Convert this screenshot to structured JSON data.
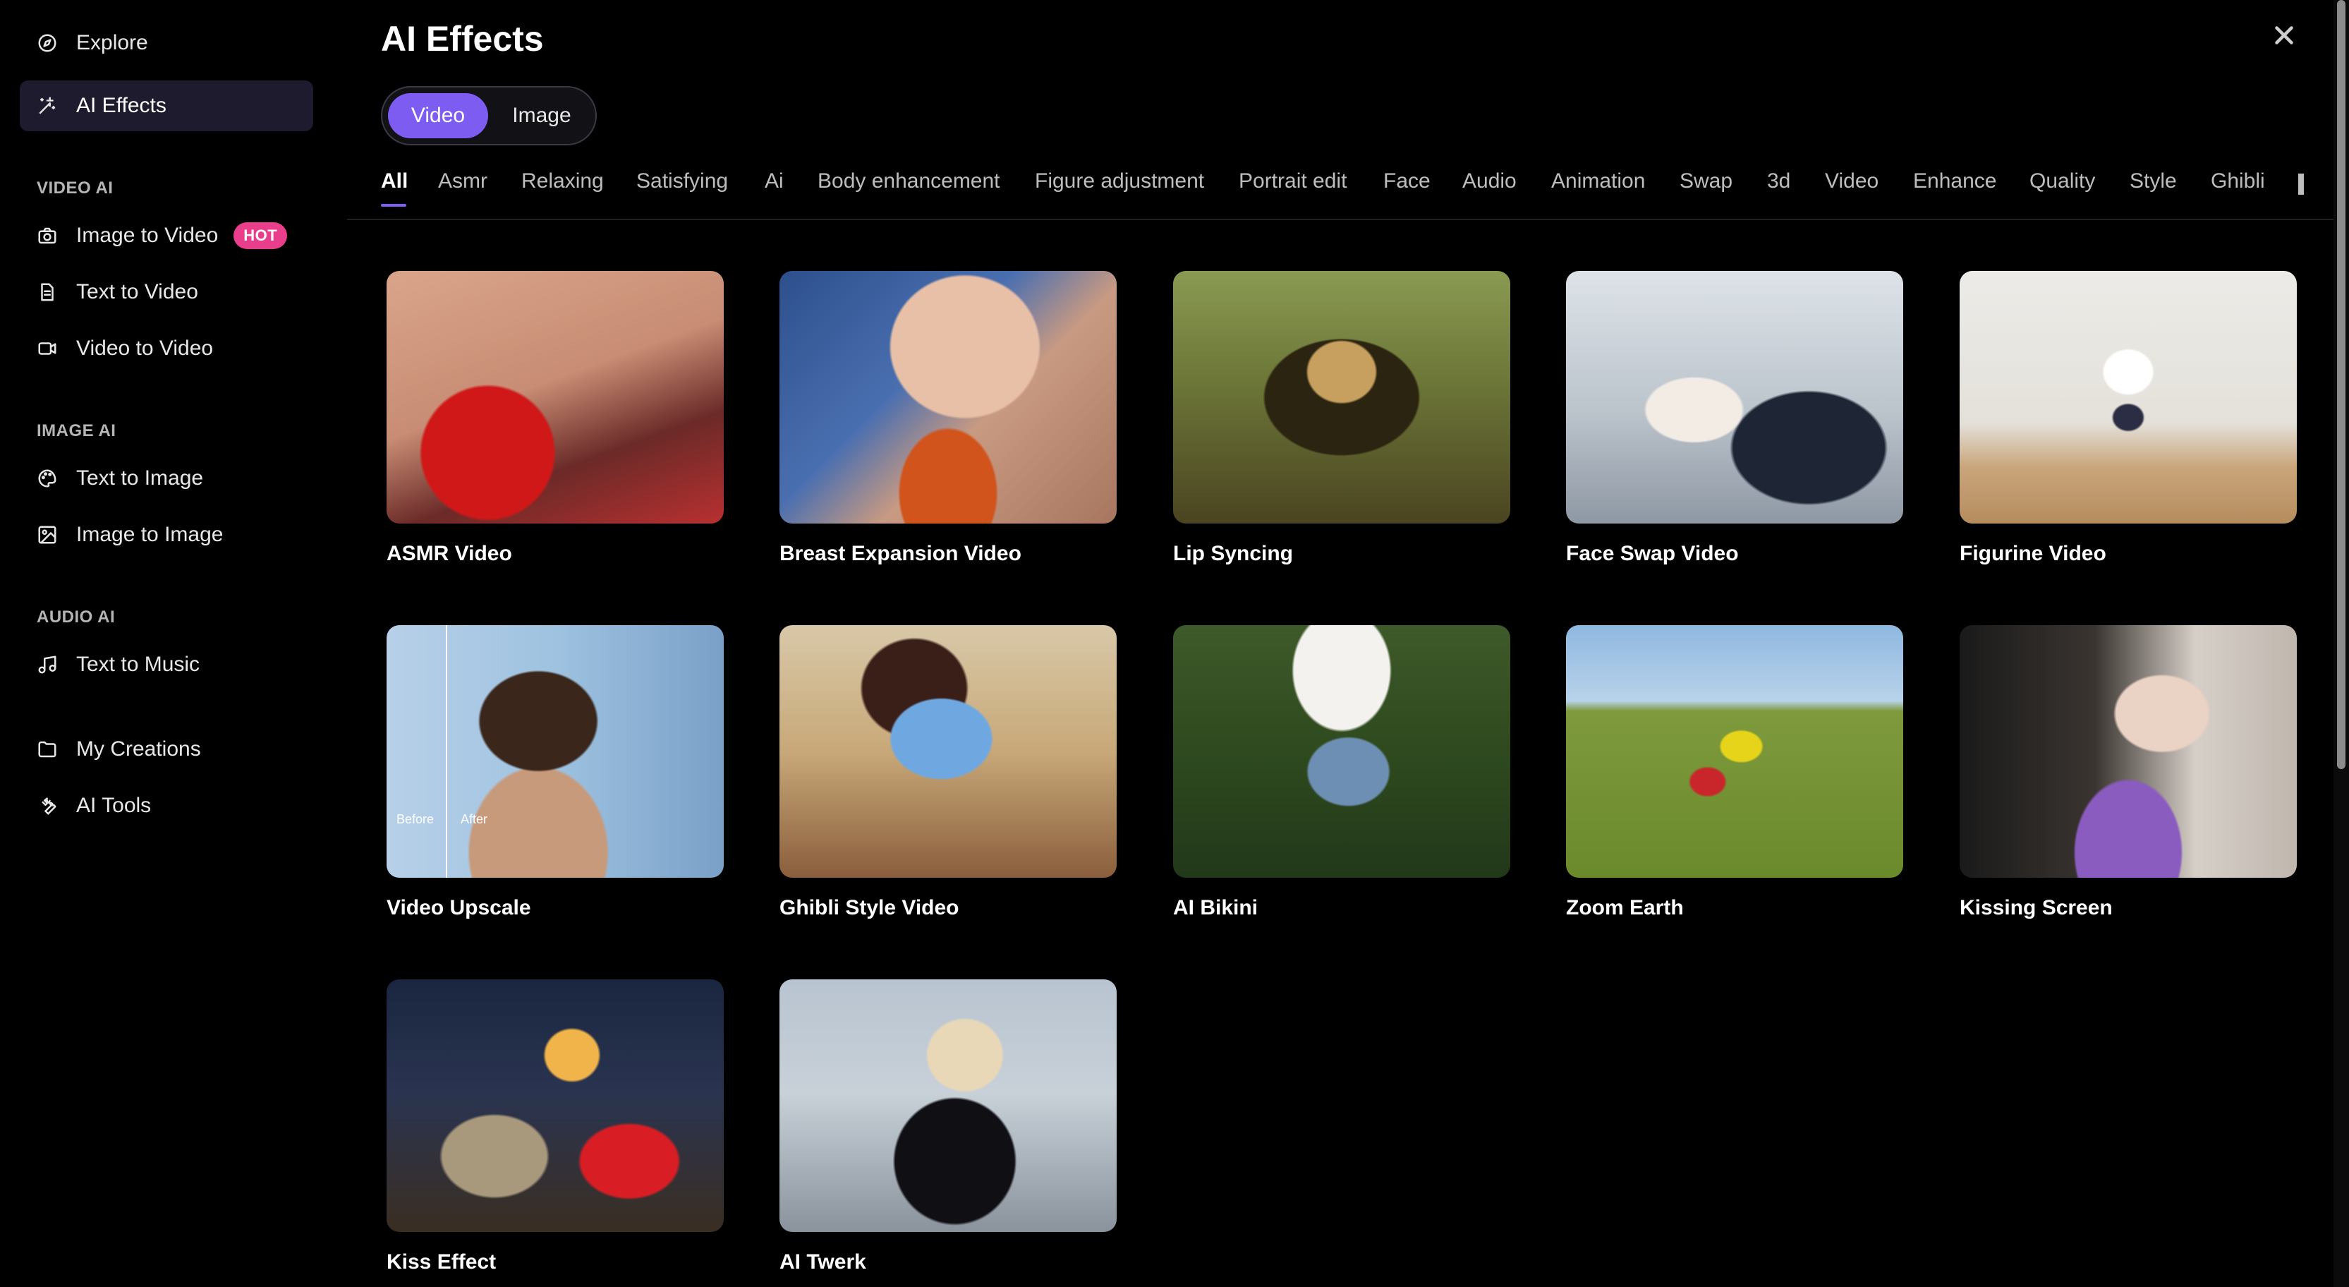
{
  "sidebar": {
    "explore": "Explore",
    "ai_effects": "AI Effects",
    "video_ai_label": "VIDEO AI",
    "image_to_video": "Image to Video",
    "hot": "HOT",
    "text_to_video": "Text to Video",
    "video_to_video": "Video to Video",
    "image_ai_label": "IMAGE AI",
    "text_to_image": "Text to Image",
    "image_to_image": "Image to Image",
    "audio_ai_label": "AUDIO AI",
    "text_to_music": "Text to Music",
    "my_creations": "My Creations",
    "ai_tools": "AI Tools"
  },
  "header": {
    "title": "AI Effects"
  },
  "toggle": {
    "video": "Video",
    "image": "Image",
    "selected": "Video"
  },
  "tabs": [
    "All",
    "Asmr",
    "Relaxing",
    "Satisfying",
    "Ai",
    "Body enhancement",
    "Figure adjustment",
    "Portrait edit",
    "Face",
    "Audio",
    "Animation",
    "Swap",
    "3d",
    "Video",
    "Enhance",
    "Quality",
    "Style",
    "Ghibli"
  ],
  "active_tab": "All",
  "cards": [
    {
      "title": "ASMR Video"
    },
    {
      "title": "Breast Expansion Video"
    },
    {
      "title": "Lip Syncing"
    },
    {
      "title": "Face Swap Video"
    },
    {
      "title": "Figurine Video"
    },
    {
      "title": "Video Upscale",
      "before": "Before",
      "after": "After"
    },
    {
      "title": "Ghibli Style Video"
    },
    {
      "title": "AI Bikini"
    },
    {
      "title": "Zoom Earth"
    },
    {
      "title": "Kissing Screen"
    },
    {
      "title": "Kiss Effect"
    },
    {
      "title": "AI Twerk"
    }
  ],
  "colors": {
    "accent": "#7c5cf1",
    "hot_badge": "#e83e8c",
    "active_nav": "#1e1b2e"
  }
}
